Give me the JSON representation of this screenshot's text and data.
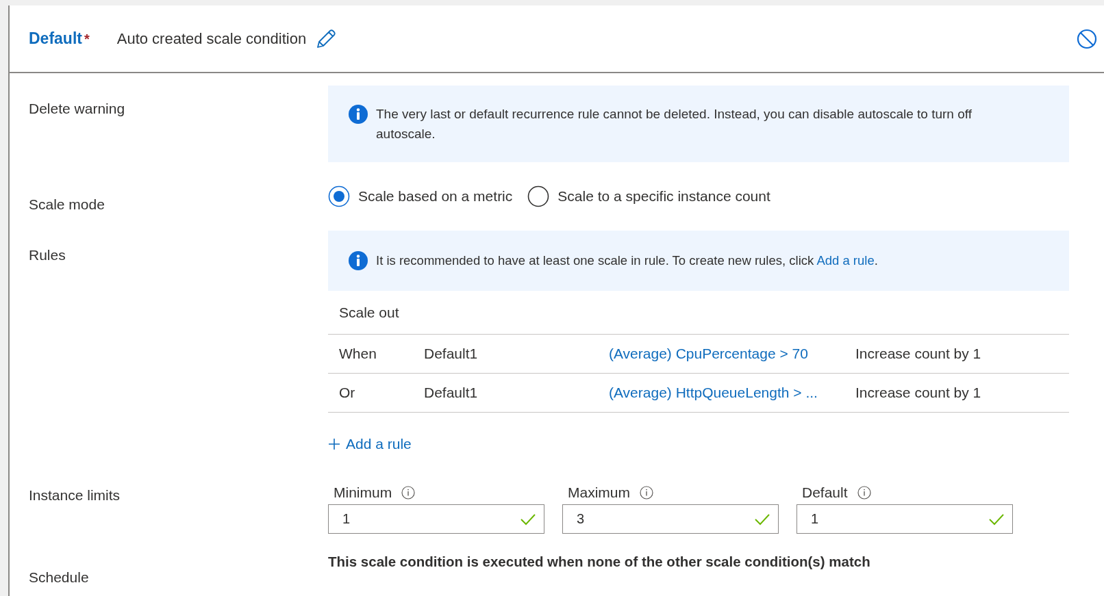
{
  "header": {
    "title": "Default",
    "required_mark": "*",
    "condition_name": "Auto created scale condition"
  },
  "delete_warning": {
    "label": "Delete warning",
    "message": "The very last or default recurrence rule cannot be deleted. Instead, you can disable autoscale to turn off autoscale."
  },
  "scale_mode": {
    "label": "Scale mode",
    "options": [
      {
        "label": "Scale based on a metric",
        "selected": true
      },
      {
        "label": "Scale to a specific instance count",
        "selected": false
      }
    ]
  },
  "rules": {
    "label": "Rules",
    "info": {
      "text": "It is recommended to have at least one scale in rule. To create new rules, click ",
      "link": "Add a rule",
      "after": "."
    },
    "section_title": "Scale out",
    "rows": [
      {
        "condition": "When",
        "name": "Default1",
        "metric": "(Average) CpuPercentage > 70",
        "action": "Increase count by 1"
      },
      {
        "condition": "Or",
        "name": "Default1",
        "metric": "(Average) HttpQueueLength > ...",
        "action": "Increase count by 1"
      }
    ],
    "add_button": "Add a rule"
  },
  "instance_limits": {
    "label": "Instance limits",
    "fields": [
      {
        "label": "Minimum",
        "value": "1",
        "valid": true
      },
      {
        "label": "Maximum",
        "value": "3",
        "valid": true
      },
      {
        "label": "Default",
        "value": "1",
        "valid": true
      }
    ]
  },
  "schedule": {
    "label": "Schedule",
    "text": "This scale condition is executed when none of the other scale condition(s) match"
  }
}
